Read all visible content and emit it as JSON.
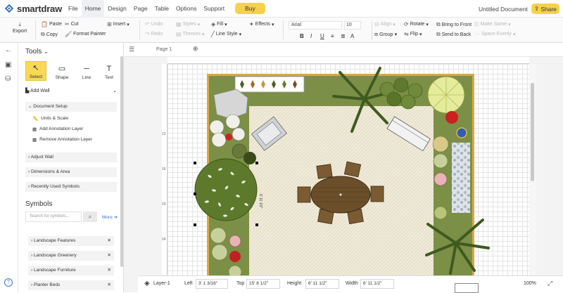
{
  "app": {
    "logo_text": "smartdraw",
    "menu": [
      "File",
      "Home",
      "Design",
      "Page",
      "Table",
      "Options",
      "Support"
    ],
    "active_menu": "Home",
    "buy_label": "Buy",
    "document_title": "Untitled Document",
    "share_label": "Share"
  },
  "ribbon": {
    "export": "Export",
    "paste": "Paste",
    "cut": "Cut",
    "copy": "Copy",
    "format_painter": "Format Painter",
    "insert": "Insert",
    "undo": "Undo",
    "redo": "Redo",
    "styles": "Styles",
    "themes": "Themes",
    "fill": "Fill",
    "line_style": "Line Style",
    "effects": "Effects",
    "font": "Arial",
    "font_size": "10",
    "bold": "B",
    "italic": "I",
    "underline": "U",
    "align": "Align",
    "group": "Group",
    "rotate": "Rotate",
    "flip": "Flip",
    "bring_to_front": "Bring to Front",
    "send_to_back": "Send to Back",
    "make_same": "Make Same",
    "space_evenly": "Space Evenly"
  },
  "tools": {
    "title": "Tools",
    "buttons": [
      "Select",
      "Shape",
      "Line",
      "Text"
    ],
    "active": "Select",
    "add_wall": "Add Wall",
    "document_setup": "Document Setup",
    "setup_items": [
      "Units & Scale",
      "Add Annotation Layer",
      "Remove Annotation Layer"
    ],
    "sections": [
      "Adjust Wall",
      "Dimensions & Area",
      "Recently Used Symbols"
    ]
  },
  "symbols": {
    "title": "Symbols",
    "search_placeholder": "Search for symbols...",
    "more_label": "More",
    "libraries": [
      "Landscape Features",
      "Landscape Greenery",
      "Landscape Furniture",
      "Planter Beds"
    ]
  },
  "pages": {
    "tab_label": "Page 1"
  },
  "rulers": {
    "left_ticks": [
      "12",
      "16",
      "20",
      "24"
    ]
  },
  "status": {
    "layer_label": "Layer-1",
    "left_label": "Left",
    "left_value": "3' 1 3/16\"",
    "top_label": "Top",
    "top_value": "15' 8 1/2\"",
    "height_label": "Height",
    "height_value": "6' 11 1/2\"",
    "width_label": "Width",
    "width_value": "6' 11 1/2\"",
    "zoom": "100%"
  },
  "colors": {
    "accent_yellow": "#f6d24a",
    "lawn_green": "#7c8f46",
    "patio_beige": "#efe9d6",
    "wood_brown": "#6b4f2a",
    "link_blue": "#3a78c3"
  }
}
